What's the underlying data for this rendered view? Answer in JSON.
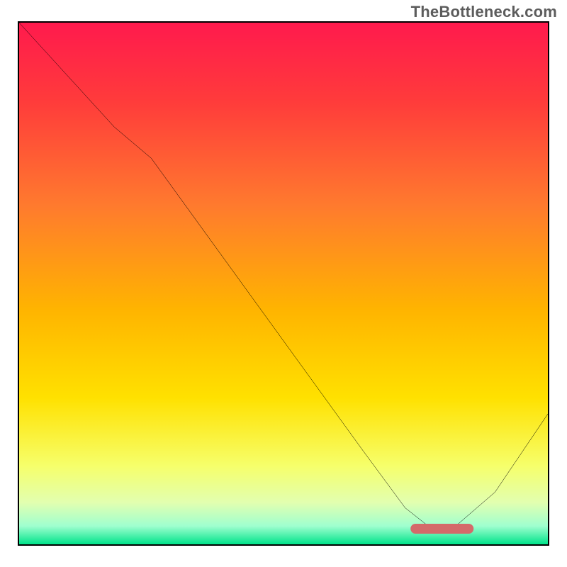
{
  "watermark": "TheBottleneck.com",
  "chart_data": {
    "type": "line",
    "title": "",
    "xlabel": "",
    "ylabel": "",
    "xlim": [
      0,
      1
    ],
    "ylim": [
      0,
      1
    ],
    "series": [
      {
        "name": "curve",
        "x": [
          0.0,
          0.09,
          0.18,
          0.25,
          0.35,
          0.45,
          0.55,
          0.65,
          0.73,
          0.78,
          0.82,
          0.9,
          1.0
        ],
        "y": [
          1.0,
          0.9,
          0.8,
          0.74,
          0.6,
          0.46,
          0.32,
          0.18,
          0.07,
          0.03,
          0.03,
          0.1,
          0.25
        ]
      }
    ],
    "marker": {
      "x_center": 0.8,
      "width_frac": 0.12,
      "y": 0.03
    },
    "gradient_stops": [
      {
        "offset": 0.0,
        "color": "#ff1a4d"
      },
      {
        "offset": 0.15,
        "color": "#ff3b3b"
      },
      {
        "offset": 0.35,
        "color": "#ff7a2e"
      },
      {
        "offset": 0.55,
        "color": "#ffb400"
      },
      {
        "offset": 0.72,
        "color": "#ffe100"
      },
      {
        "offset": 0.85,
        "color": "#f6ff6b"
      },
      {
        "offset": 0.92,
        "color": "#e2ffb0"
      },
      {
        "offset": 0.965,
        "color": "#9fffcf"
      },
      {
        "offset": 1.0,
        "color": "#00e38a"
      }
    ]
  }
}
